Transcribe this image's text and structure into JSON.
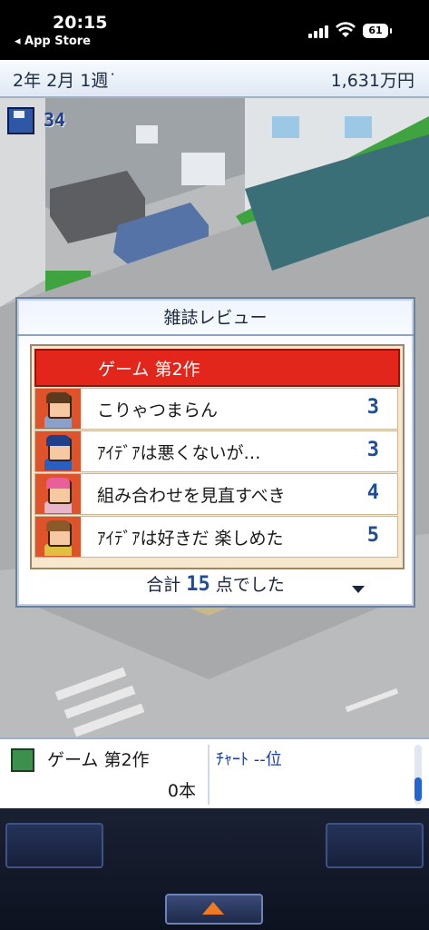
{
  "status_bar": {
    "time": "20:15",
    "back_label": "◂ App Store",
    "battery": "61"
  },
  "top_bar": {
    "date": "2年  2月  1週˙",
    "money": "1,631万円"
  },
  "scene": {
    "save_count": "34"
  },
  "dialog": {
    "title": "雑誌レビュー",
    "header": "ゲーム  第2作",
    "reviews": [
      {
        "text": "こりゃつまらん",
        "score": "3",
        "hair_color": "#5b3a1e",
        "shirt_color": "#8aa0c8"
      },
      {
        "text": "ｱｲﾃﾞｱは悪くないが…",
        "score": "3",
        "hair_color": "#1e3f8a",
        "shirt_color": "#2b5fbf"
      },
      {
        "text": "組み合わせを見直すべき",
        "score": "4",
        "hair_color": "#e85f9a",
        "shirt_color": "#e8b5c9"
      },
      {
        "text": "ｱｲﾃﾞｱは好きだ 楽しめた",
        "score": "5",
        "hair_color": "#8a5a2a",
        "shirt_color": "#e0c040"
      }
    ],
    "total_prefix": "合計",
    "total_value": "15",
    "total_suffix": "点でした"
  },
  "bottom_panel": {
    "game_name": "ゲーム  第2作",
    "sales": "0本",
    "chart_rank": "ﾁｬｰﾄ --位"
  },
  "colors": {
    "header_red": "#e3261b",
    "score_blue": "#1e4c96",
    "avatar_bg": "#e0532a"
  }
}
